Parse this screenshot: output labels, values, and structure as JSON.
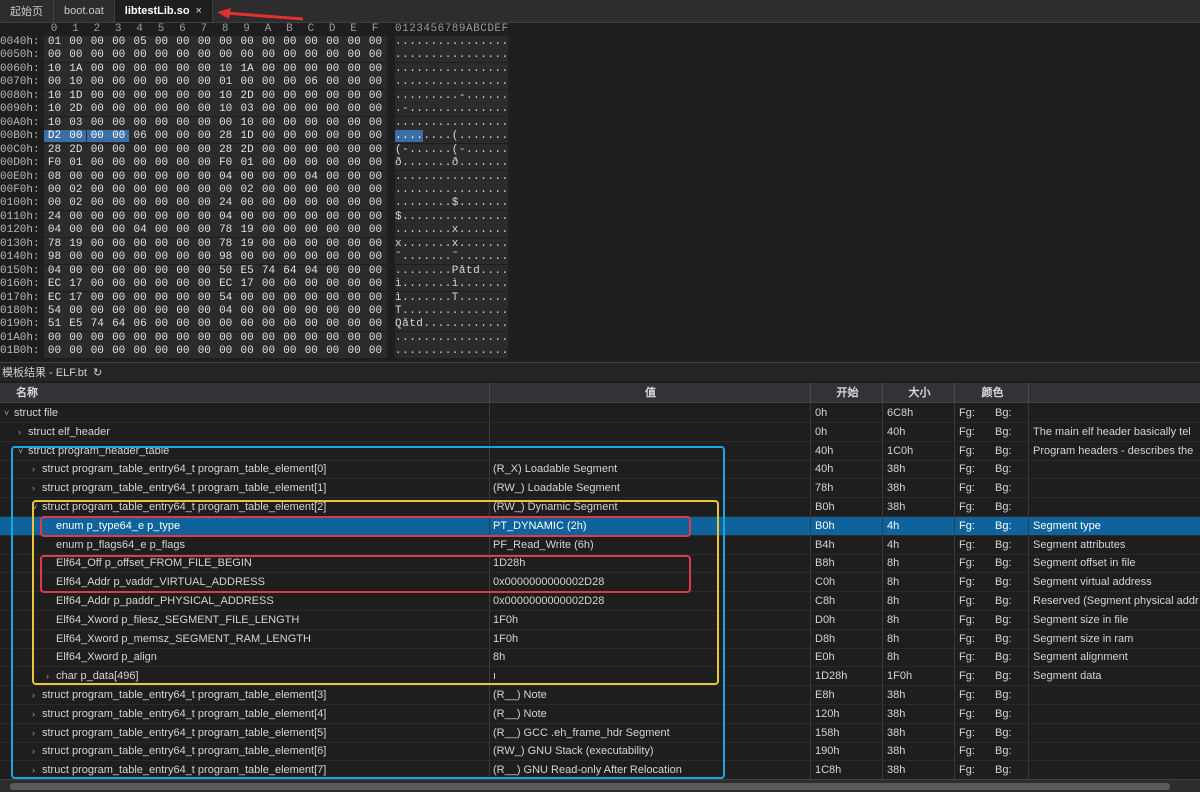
{
  "tabs": [
    {
      "label": "起始页",
      "active": false
    },
    {
      "label": "boot.oat",
      "active": false
    },
    {
      "label": "libtestLib.so",
      "active": true,
      "close": "×"
    }
  ],
  "hex": {
    "columns": [
      "0",
      "1",
      "2",
      "3",
      "4",
      "5",
      "6",
      "7",
      "8",
      "9",
      "A",
      "B",
      "C",
      "D",
      "E",
      "F"
    ],
    "ascii_header": "0123456789ABCDEF",
    "rows": [
      {
        "addr": "0040h:",
        "bytes": [
          "01",
          "00",
          "00",
          "00",
          "05",
          "00",
          "00",
          "00",
          "00",
          "00",
          "00",
          "00",
          "00",
          "00",
          "00",
          "00"
        ],
        "ascii": "................"
      },
      {
        "addr": "0050h:",
        "bytes": [
          "00",
          "00",
          "00",
          "00",
          "00",
          "00",
          "00",
          "00",
          "00",
          "00",
          "00",
          "00",
          "00",
          "00",
          "00",
          "00"
        ],
        "ascii": "................"
      },
      {
        "addr": "0060h:",
        "bytes": [
          "10",
          "1A",
          "00",
          "00",
          "00",
          "00",
          "00",
          "00",
          "10",
          "1A",
          "00",
          "00",
          "00",
          "00",
          "00",
          "00"
        ],
        "ascii": "................"
      },
      {
        "addr": "0070h:",
        "bytes": [
          "00",
          "10",
          "00",
          "00",
          "00",
          "00",
          "00",
          "00",
          "01",
          "00",
          "00",
          "00",
          "06",
          "00",
          "00",
          "00"
        ],
        "ascii": "................"
      },
      {
        "addr": "0080h:",
        "bytes": [
          "10",
          "1D",
          "00",
          "00",
          "00",
          "00",
          "00",
          "00",
          "10",
          "2D",
          "00",
          "00",
          "00",
          "00",
          "00",
          "00"
        ],
        "ascii": ".........-......"
      },
      {
        "addr": "0090h:",
        "bytes": [
          "10",
          "2D",
          "00",
          "00",
          "00",
          "00",
          "00",
          "00",
          "10",
          "03",
          "00",
          "00",
          "00",
          "00",
          "00",
          "00"
        ],
        "ascii": ".-.............."
      },
      {
        "addr": "00A0h:",
        "bytes": [
          "10",
          "03",
          "00",
          "00",
          "00",
          "00",
          "00",
          "00",
          "00",
          "10",
          "00",
          "00",
          "00",
          "00",
          "00",
          "00"
        ],
        "ascii": "................"
      },
      {
        "addr": "00B0h:",
        "bytes": [
          "D2",
          "00",
          "00",
          "00",
          "06",
          "00",
          "00",
          "00",
          "28",
          "1D",
          "00",
          "00",
          "00",
          "00",
          "00",
          "00"
        ],
        "ascii": "........(.......",
        "sel": 4
      },
      {
        "addr": "00C0h:",
        "bytes": [
          "28",
          "2D",
          "00",
          "00",
          "00",
          "00",
          "00",
          "00",
          "28",
          "2D",
          "00",
          "00",
          "00",
          "00",
          "00",
          "00"
        ],
        "ascii": "(-......(-......"
      },
      {
        "addr": "00D0h:",
        "bytes": [
          "F0",
          "01",
          "00",
          "00",
          "00",
          "00",
          "00",
          "00",
          "F0",
          "01",
          "00",
          "00",
          "00",
          "00",
          "00",
          "00"
        ],
        "ascii": "ð.......ð......."
      },
      {
        "addr": "00E0h:",
        "bytes": [
          "08",
          "00",
          "00",
          "00",
          "00",
          "00",
          "00",
          "00",
          "04",
          "00",
          "00",
          "00",
          "04",
          "00",
          "00",
          "00"
        ],
        "ascii": "................"
      },
      {
        "addr": "00F0h:",
        "bytes": [
          "00",
          "02",
          "00",
          "00",
          "00",
          "00",
          "00",
          "00",
          "00",
          "02",
          "00",
          "00",
          "00",
          "00",
          "00",
          "00"
        ],
        "ascii": "................"
      },
      {
        "addr": "0100h:",
        "bytes": [
          "00",
          "02",
          "00",
          "00",
          "00",
          "00",
          "00",
          "00",
          "24",
          "00",
          "00",
          "00",
          "00",
          "00",
          "00",
          "00"
        ],
        "ascii": "........$......."
      },
      {
        "addr": "0110h:",
        "bytes": [
          "24",
          "00",
          "00",
          "00",
          "00",
          "00",
          "00",
          "00",
          "04",
          "00",
          "00",
          "00",
          "00",
          "00",
          "00",
          "00"
        ],
        "ascii": "$..............."
      },
      {
        "addr": "0120h:",
        "bytes": [
          "04",
          "00",
          "00",
          "00",
          "04",
          "00",
          "00",
          "00",
          "78",
          "19",
          "00",
          "00",
          "00",
          "00",
          "00",
          "00"
        ],
        "ascii": "........x......."
      },
      {
        "addr": "0130h:",
        "bytes": [
          "78",
          "19",
          "00",
          "00",
          "00",
          "00",
          "00",
          "00",
          "78",
          "19",
          "00",
          "00",
          "00",
          "00",
          "00",
          "00"
        ],
        "ascii": "x.......x......."
      },
      {
        "addr": "0140h:",
        "bytes": [
          "98",
          "00",
          "00",
          "00",
          "00",
          "00",
          "00",
          "00",
          "98",
          "00",
          "00",
          "00",
          "00",
          "00",
          "00",
          "00"
        ],
        "ascii": "˜.......˜......."
      },
      {
        "addr": "0150h:",
        "bytes": [
          "04",
          "00",
          "00",
          "00",
          "00",
          "00",
          "00",
          "00",
          "50",
          "E5",
          "74",
          "64",
          "04",
          "00",
          "00",
          "00"
        ],
        "ascii": "........Påtd...."
      },
      {
        "addr": "0160h:",
        "bytes": [
          "EC",
          "17",
          "00",
          "00",
          "00",
          "00",
          "00",
          "00",
          "EC",
          "17",
          "00",
          "00",
          "00",
          "00",
          "00",
          "00"
        ],
        "ascii": "ì.......ì......."
      },
      {
        "addr": "0170h:",
        "bytes": [
          "EC",
          "17",
          "00",
          "00",
          "00",
          "00",
          "00",
          "00",
          "54",
          "00",
          "00",
          "00",
          "00",
          "00",
          "00",
          "00"
        ],
        "ascii": "ì.......T......."
      },
      {
        "addr": "0180h:",
        "bytes": [
          "54",
          "00",
          "00",
          "00",
          "00",
          "00",
          "00",
          "00",
          "04",
          "00",
          "00",
          "00",
          "00",
          "00",
          "00",
          "00"
        ],
        "ascii": "T..............."
      },
      {
        "addr": "0190h:",
        "bytes": [
          "51",
          "E5",
          "74",
          "64",
          "06",
          "00",
          "00",
          "00",
          "00",
          "00",
          "00",
          "00",
          "00",
          "00",
          "00",
          "00"
        ],
        "ascii": "Qåtd............"
      },
      {
        "addr": "01A0h:",
        "bytes": [
          "00",
          "00",
          "00",
          "00",
          "00",
          "00",
          "00",
          "00",
          "00",
          "00",
          "00",
          "00",
          "00",
          "00",
          "00",
          "00"
        ],
        "ascii": "................"
      },
      {
        "addr": "01B0h:",
        "bytes": [
          "00",
          "00",
          "00",
          "00",
          "00",
          "00",
          "00",
          "00",
          "00",
          "00",
          "00",
          "00",
          "00",
          "00",
          "00",
          "00"
        ],
        "ascii": "................"
      }
    ]
  },
  "panel": {
    "title": "模板结果 - ELF.bt",
    "refresh_icon": "↻"
  },
  "grid": {
    "headers": {
      "name": "名称",
      "value": "值",
      "start": "开始",
      "size": "大小",
      "color": "颜色"
    },
    "rows": [
      {
        "indent": 0,
        "twisty": "˅",
        "name": "struct file",
        "value": "",
        "start": "0h",
        "size": "6C8h",
        "fg": "Fg:",
        "bg": "Bg:",
        "comment": ""
      },
      {
        "indent": 1,
        "twisty": "›",
        "name": "struct elf_header",
        "value": "",
        "start": "0h",
        "size": "40h",
        "fg": "Fg:",
        "bg": "Bg:",
        "comment": "The main elf header basically tel"
      },
      {
        "indent": 1,
        "twisty": "˅",
        "name": "struct program_header_table",
        "value": "",
        "start": "40h",
        "size": "1C0h",
        "fg": "Fg:",
        "bg": "Bg:",
        "comment": "Program headers - describes the"
      },
      {
        "indent": 2,
        "twisty": "›",
        "name": "struct program_table_entry64_t program_table_element[0]",
        "value": "(R_X) Loadable Segment",
        "start": "40h",
        "size": "38h",
        "fg": "Fg:",
        "bg": "Bg:",
        "comment": ""
      },
      {
        "indent": 2,
        "twisty": "›",
        "name": "struct program_table_entry64_t program_table_element[1]",
        "value": "(RW_) Loadable Segment",
        "start": "78h",
        "size": "38h",
        "fg": "Fg:",
        "bg": "Bg:",
        "comment": ""
      },
      {
        "indent": 2,
        "twisty": "˅",
        "name": "struct program_table_entry64_t program_table_element[2]",
        "value": "(RW_) Dynamic Segment",
        "start": "B0h",
        "size": "38h",
        "fg": "Fg:",
        "bg": "Bg:",
        "comment": ""
      },
      {
        "indent": 3,
        "twisty": "",
        "name": "enum p_type64_e p_type",
        "value": "PT_DYNAMIC (2h)",
        "start": "B0h",
        "size": "4h",
        "fg": "Fg:",
        "bg": "Bg:",
        "comment": "Segment type",
        "selected": true
      },
      {
        "indent": 3,
        "twisty": "",
        "name": "enum p_flags64_e p_flags",
        "value": "PF_Read_Write (6h)",
        "start": "B4h",
        "size": "4h",
        "fg": "Fg:",
        "bg": "Bg:",
        "comment": "Segment attributes"
      },
      {
        "indent": 3,
        "twisty": "",
        "name": "Elf64_Off p_offset_FROM_FILE_BEGIN",
        "value": "1D28h",
        "start": "B8h",
        "size": "8h",
        "fg": "Fg:",
        "bg": "Bg:",
        "comment": "Segment offset in file"
      },
      {
        "indent": 3,
        "twisty": "",
        "name": "Elf64_Addr p_vaddr_VIRTUAL_ADDRESS",
        "value": "0x0000000000002D28",
        "start": "C0h",
        "size": "8h",
        "fg": "Fg:",
        "bg": "Bg:",
        "comment": "Segment virtual address"
      },
      {
        "indent": 3,
        "twisty": "",
        "name": "Elf64_Addr p_paddr_PHYSICAL_ADDRESS",
        "value": "0x0000000000002D28",
        "start": "C8h",
        "size": "8h",
        "fg": "Fg:",
        "bg": "Bg:",
        "comment": "Reserved (Segment physical addr"
      },
      {
        "indent": 3,
        "twisty": "",
        "name": "Elf64_Xword p_filesz_SEGMENT_FILE_LENGTH",
        "value": "1F0h",
        "start": "D0h",
        "size": "8h",
        "fg": "Fg:",
        "bg": "Bg:",
        "comment": "Segment size in file"
      },
      {
        "indent": 3,
        "twisty": "",
        "name": "Elf64_Xword p_memsz_SEGMENT_RAM_LENGTH",
        "value": "1F0h",
        "start": "D8h",
        "size": "8h",
        "fg": "Fg:",
        "bg": "Bg:",
        "comment": "Segment size in ram"
      },
      {
        "indent": 3,
        "twisty": "",
        "name": "Elf64_Xword p_align",
        "value": "8h",
        "start": "E0h",
        "size": "8h",
        "fg": "Fg:",
        "bg": "Bg:",
        "comment": "Segment alignment"
      },
      {
        "indent": 3,
        "twisty": "›",
        "name": "char p_data[496]",
        "value": "ı",
        "start": "1D28h",
        "size": "1F0h",
        "fg": "Fg:",
        "bg": "Bg:",
        "comment": "Segment data"
      },
      {
        "indent": 2,
        "twisty": "›",
        "name": "struct program_table_entry64_t program_table_element[3]",
        "value": "(R__) Note",
        "start": "E8h",
        "size": "38h",
        "fg": "Fg:",
        "bg": "Bg:",
        "comment": ""
      },
      {
        "indent": 2,
        "twisty": "›",
        "name": "struct program_table_entry64_t program_table_element[4]",
        "value": "(R__) Note",
        "start": "120h",
        "size": "38h",
        "fg": "Fg:",
        "bg": "Bg:",
        "comment": ""
      },
      {
        "indent": 2,
        "twisty": "›",
        "name": "struct program_table_entry64_t program_table_element[5]",
        "value": "(R__) GCC .eh_frame_hdr Segment",
        "start": "158h",
        "size": "38h",
        "fg": "Fg:",
        "bg": "Bg:",
        "comment": ""
      },
      {
        "indent": 2,
        "twisty": "›",
        "name": "struct program_table_entry64_t program_table_element[6]",
        "value": "(RW_) GNU Stack (executability)",
        "start": "190h",
        "size": "38h",
        "fg": "Fg:",
        "bg": "Bg:",
        "comment": ""
      },
      {
        "indent": 2,
        "twisty": "›",
        "name": "struct program_table_entry64_t program_table_element[7]",
        "value": "(R__) GNU Read-only After Relocation",
        "start": "1C8h",
        "size": "38h",
        "fg": "Fg:",
        "bg": "Bg:",
        "comment": ""
      }
    ]
  },
  "colors": {
    "selection": "#0e639c",
    "annot_blue": "#19a7e0",
    "annot_yellow": "#e8c63c",
    "annot_red": "#e03a4a",
    "arrow": "#e0312f"
  }
}
